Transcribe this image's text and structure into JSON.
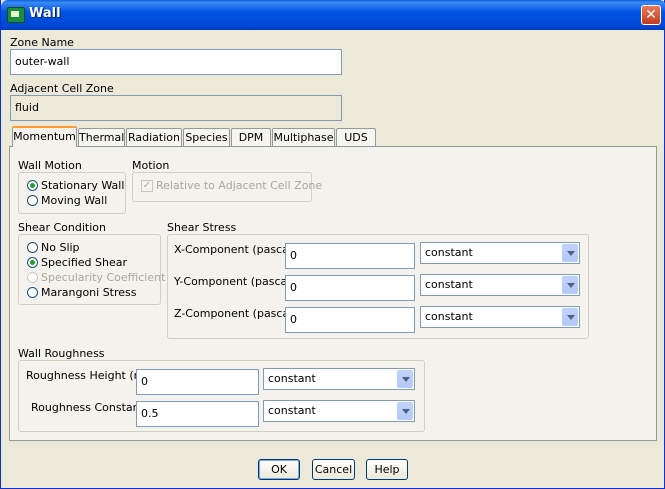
{
  "window": {
    "title": "Wall",
    "close_label": "✕"
  },
  "zone_name": {
    "label": "Zone Name",
    "value": "outer-wall"
  },
  "adjacent": {
    "label": "Adjacent Cell Zone",
    "value": "fluid"
  },
  "tabs": [
    {
      "label": "Momentum",
      "active": true
    },
    {
      "label": "Thermal"
    },
    {
      "label": "Radiation"
    },
    {
      "label": "Species"
    },
    {
      "label": "DPM"
    },
    {
      "label": "Multiphase"
    },
    {
      "label": "UDS"
    }
  ],
  "wall_motion": {
    "label": "Wall Motion",
    "options": [
      "Stationary Wall",
      "Moving Wall"
    ],
    "selected": "Stationary Wall"
  },
  "motion": {
    "label": "Motion",
    "checkbox": "Relative to Adjacent Cell Zone",
    "checked": true
  },
  "shear_condition": {
    "label": "Shear Condition",
    "options": [
      "No Slip",
      "Specified Shear",
      "Specularity Coefficient",
      "Marangoni Stress"
    ],
    "selected": "Specified Shear"
  },
  "shear_stress": {
    "label": "Shear Stress",
    "rows": [
      {
        "label": "X-Component (pascal)",
        "value": "0",
        "method": "constant"
      },
      {
        "label": "Y-Component (pascal)",
        "value": "0",
        "method": "constant"
      },
      {
        "label": "Z-Component (pascal)",
        "value": "0",
        "method": "constant"
      }
    ]
  },
  "roughness": {
    "label": "Wall Roughness",
    "rows": [
      {
        "label": "Roughness Height (m)",
        "value": "0",
        "method": "constant"
      },
      {
        "label": "Roughness Constant",
        "value": "0.5",
        "method": "constant"
      }
    ]
  },
  "buttons": {
    "ok": "OK",
    "cancel": "Cancel",
    "help": "Help"
  }
}
